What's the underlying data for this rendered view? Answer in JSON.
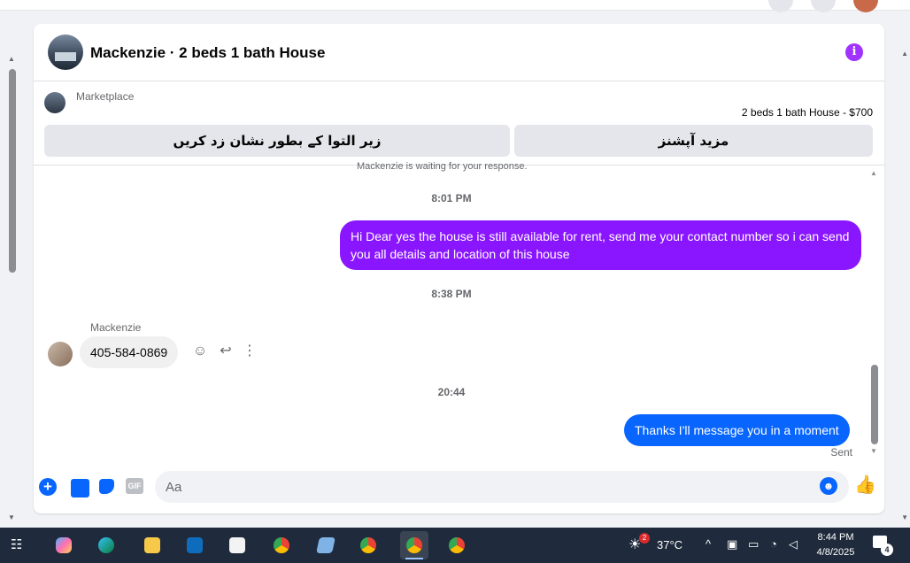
{
  "chat": {
    "title": "Mackenzie · 2 beds 1 bath House",
    "marketplace": {
      "label": "Marketplace",
      "listing": "2 beds 1 bath House - $700",
      "btn_mark_sold": "زیر التوا کے بطور نشان زد کریں",
      "btn_more_options": "مزید آپشنز"
    },
    "messages": {
      "cut_off_text": "Mackenzie is waiting for your response.",
      "timestamp_1": "8:01 PM",
      "outgoing_1": "Hi Dear yes the house is still available for rent, send me your contact number so i can send you all details and location of this house",
      "timestamp_2": "8:38 PM",
      "sender_name": "Mackenzie",
      "incoming_1": "405-584-0869",
      "timestamp_3": "20:44",
      "outgoing_2": "Thanks I'll message you in a moment",
      "status": "Sent"
    },
    "composer": {
      "placeholder": "Aa",
      "gif_label": "GIF"
    }
  },
  "taskbar": {
    "weather_temp": "37°C",
    "weather_badge": "2",
    "time": "8:44 PM",
    "date": "4/8/2025",
    "notification_count": "4"
  },
  "colors": {
    "accent_purple": "#8a16ff",
    "messenger_blue": "#0866ff",
    "info_purple": "#a033ff",
    "taskbar_bg": "#1f2b3c"
  }
}
